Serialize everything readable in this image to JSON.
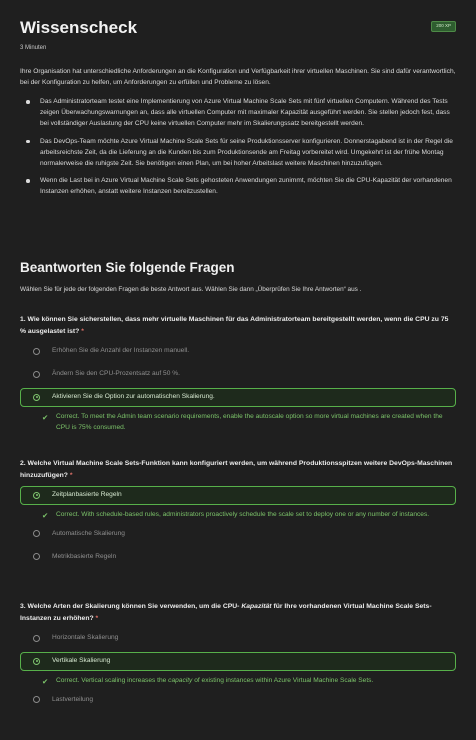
{
  "header": {
    "title": "Wissenscheck",
    "xp_badge": "200 XP",
    "duration": "3 Minuten"
  },
  "intro": "Ihre Organisation hat unterschiedliche Anforderungen an die Konfiguration und Verfügbarkeit ihrer virtuellen Maschinen. Sie sind dafür verantwortlich, bei der Konfiguration zu helfen, um Anforderungen zu erfüllen und Probleme zu lösen.",
  "scenarios": [
    "Das Administratorteam testet eine Implementierung von Azure Virtual Machine Scale Sets mit fünf virtuellen Computern. Während des Tests zeigen Überwachungswarnungen an, dass alle virtuellen Computer mit maximaler Kapazität ausgeführt werden. Sie stellen jedoch fest, dass bei vollständiger Auslastung der CPU keine virtuellen Computer mehr im Skalierungssatz bereitgestellt werden.",
    "Das DevOps-Team möchte Azure Virtual Machine Scale Sets für seine Produktionsserver konfigurieren. Donnerstagabend ist in der Regel die arbeitsreichste Zeit, da die Lieferung an die Kunden bis zum Produktionsende am Freitag vorbereitet wird. Umgekehrt ist der frühe Montag normalerweise die ruhigste Zeit. Sie benötigen einen Plan, um bei hoher Arbeitslast weitere Maschinen hinzuzufügen.",
    "Wenn die Last bei in Azure Virtual Machine Scale Sets gehosteten Anwendungen zunimmt, möchten Sie die CPU-Kapazität der vorhandenen Instanzen erhöhen, anstatt weitere Instanzen bereitzustellen."
  ],
  "section_heading": "Beantworten Sie folgende Fragen",
  "instructions": "Wählen Sie für jede der folgenden Fragen die beste Antwort aus. Wählen Sie dann „Überprüfen Sie Ihre Antworten“ aus .",
  "questions": [
    {
      "text": "1. Wie können Sie sicherstellen, dass mehr virtuelle Maschinen für das Administratorteam bereitgestellt werden, wenn die CPU zu 75 % ausgelastet ist?",
      "required_mark": "*",
      "options": [
        "Erhöhen Sie die Anzahl der Instanzen manuell.",
        "Ändern Sie den CPU-Prozentsatz auf 50 %.",
        "Aktivieren Sie die Option zur automatischen Skalierung."
      ],
      "selected_index": 2,
      "feedback": "Correct. To meet the Admin team scenario requirements, enable the autoscale option so more virtual machines are created when the CPU is 75% consumed."
    },
    {
      "text": "2. Welche Virtual Machine Scale Sets-Funktion kann konfiguriert werden, um während Produktionsspitzen weitere DevOps-Maschinen hinzuzufügen?",
      "required_mark": "*",
      "options": [
        "Zeitplanbasierte Regeln",
        "Automatische Skalierung",
        "Metrikbasierte Regeln"
      ],
      "selected_index": 0,
      "feedback": "Correct. With schedule-based rules, administrators proactively schedule the scale set to deploy one or any number of instances."
    },
    {
      "text_before": "3. Welche Arten der Skalierung können Sie verwenden, um die CPU-",
      "text_emphasis": "Kapazität",
      "text_after": "für Ihre vorhandenen Virtual Machine Scale Sets-Instanzen zu erhöhen?",
      "required_mark": "*",
      "options": [
        "Horizontale Skalierung",
        "Vertikale Skalierung",
        "Lastverteilung"
      ],
      "selected_index": 1,
      "feedback_before": "Correct. Vertical scaling increases the",
      "feedback_emphasis": "capacity",
      "feedback_after": "of existing instances within Azure Virtual Machine Scale Sets."
    }
  ],
  "colors": {
    "background": "#1f1f1f",
    "correct_green": "#7cc46a",
    "selected_border": "#57b04a",
    "required_red": "#e0726a",
    "xp_badge_bg": "#2e5d2f"
  },
  "icons": {
    "radio": "radio-icon",
    "checkmark": "checkmark-icon"
  }
}
